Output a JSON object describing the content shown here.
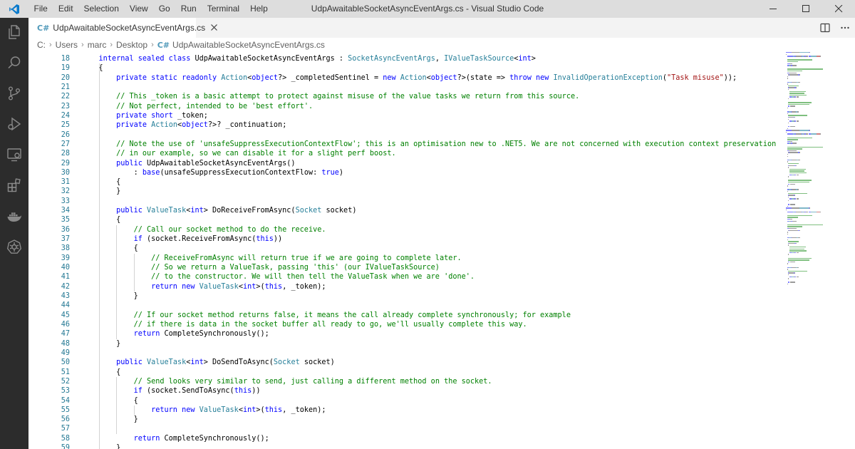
{
  "window": {
    "title": "UdpAwaitableSocketAsyncEventArgs.cs - Visual Studio Code",
    "menu": [
      "File",
      "Edit",
      "Selection",
      "View",
      "Go",
      "Run",
      "Terminal",
      "Help"
    ]
  },
  "activity_bar": {
    "icons": [
      "explorer-icon",
      "search-icon",
      "source-control-icon",
      "run-debug-icon",
      "remote-explorer-icon",
      "extensions-icon",
      "docker-icon",
      "kubernetes-icon"
    ]
  },
  "tabs": [
    {
      "label": "UdpAwaitableSocketAsyncEventArgs.cs",
      "icon": "csharp-file-icon",
      "active": true
    }
  ],
  "breadcrumb": [
    "C:",
    "Users",
    "marc",
    "Desktop",
    "UdpAwaitableSocketAsyncEventArgs.cs"
  ],
  "colors": {
    "keyword": "#0000ff",
    "type": "#267f99",
    "comment": "#008000",
    "string": "#a31515",
    "line_number": "#237893",
    "activity_bar": "#2c2c2c",
    "title_bar": "#dddddd"
  },
  "code": [
    {
      "n": "18",
      "indent": 4,
      "tokens": [
        [
          "k",
          "internal sealed class "
        ],
        [
          "p",
          "UdpAwaitableSocketAsyncEventArgs : "
        ],
        [
          "t",
          "SocketAsyncEventArgs"
        ],
        [
          "p",
          ", "
        ],
        [
          "t",
          "IValueTaskSource"
        ],
        [
          "p",
          "<"
        ],
        [
          "k",
          "int"
        ],
        [
          "p",
          ">"
        ]
      ]
    },
    {
      "n": "19",
      "indent": 4,
      "tokens": [
        [
          "p",
          "{"
        ]
      ]
    },
    {
      "n": "20",
      "indent": 8,
      "tokens": [
        [
          "k",
          "private static readonly "
        ],
        [
          "t",
          "Action"
        ],
        [
          "p",
          "<"
        ],
        [
          "k",
          "object"
        ],
        [
          "p",
          "?> _completedSentinel = "
        ],
        [
          "k",
          "new "
        ],
        [
          "t",
          "Action"
        ],
        [
          "p",
          "<"
        ],
        [
          "k",
          "object"
        ],
        [
          "p",
          "?>(state => "
        ],
        [
          "k",
          "throw new "
        ],
        [
          "t",
          "InvalidOperationException"
        ],
        [
          "p",
          "("
        ],
        [
          "s",
          "\"Task misuse\""
        ],
        [
          "p",
          "));"
        ]
      ]
    },
    {
      "n": "21",
      "indent": 0,
      "tokens": []
    },
    {
      "n": "22",
      "indent": 8,
      "tokens": [
        [
          "c",
          "// This _token is a basic attempt to protect against misuse of the value tasks we return from this source."
        ]
      ]
    },
    {
      "n": "23",
      "indent": 8,
      "tokens": [
        [
          "c",
          "// Not perfect, intended to be 'best effort'."
        ]
      ]
    },
    {
      "n": "24",
      "indent": 8,
      "tokens": [
        [
          "k",
          "private short "
        ],
        [
          "p",
          "_token;"
        ]
      ]
    },
    {
      "n": "25",
      "indent": 8,
      "tokens": [
        [
          "k",
          "private "
        ],
        [
          "t",
          "Action"
        ],
        [
          "p",
          "<"
        ],
        [
          "k",
          "object"
        ],
        [
          "p",
          "?>? _continuation;"
        ]
      ]
    },
    {
      "n": "26",
      "indent": 0,
      "tokens": []
    },
    {
      "n": "27",
      "indent": 8,
      "tokens": [
        [
          "c",
          "// Note the use of 'unsafeSuppressExecutionContextFlow'; this is an optimisation new to .NET5. We are not concerned with execution context preservation"
        ]
      ]
    },
    {
      "n": "28",
      "indent": 8,
      "tokens": [
        [
          "c",
          "// in our example, so we can disable it for a slight perf boost."
        ]
      ]
    },
    {
      "n": "29",
      "indent": 8,
      "tokens": [
        [
          "k",
          "public "
        ],
        [
          "p",
          "UdpAwaitableSocketAsyncEventArgs()"
        ]
      ]
    },
    {
      "n": "30",
      "indent": 12,
      "tokens": [
        [
          "p",
          ": "
        ],
        [
          "k",
          "base"
        ],
        [
          "p",
          "(unsafeSuppressExecutionContextFlow: "
        ],
        [
          "k",
          "true"
        ],
        [
          "p",
          ")"
        ]
      ]
    },
    {
      "n": "31",
      "indent": 8,
      "tokens": [
        [
          "p",
          "{"
        ]
      ]
    },
    {
      "n": "32",
      "indent": 8,
      "tokens": [
        [
          "p",
          "}"
        ]
      ]
    },
    {
      "n": "33",
      "indent": 0,
      "tokens": []
    },
    {
      "n": "34",
      "indent": 8,
      "tokens": [
        [
          "k",
          "public "
        ],
        [
          "t",
          "ValueTask"
        ],
        [
          "p",
          "<"
        ],
        [
          "k",
          "int"
        ],
        [
          "p",
          "> DoReceiveFromAsync("
        ],
        [
          "t",
          "Socket"
        ],
        [
          "p",
          " socket)"
        ]
      ]
    },
    {
      "n": "35",
      "indent": 8,
      "tokens": [
        [
          "p",
          "{"
        ]
      ]
    },
    {
      "n": "36",
      "indent": 12,
      "tokens": [
        [
          "c",
          "// Call our socket method to do the receive."
        ]
      ]
    },
    {
      "n": "37",
      "indent": 12,
      "tokens": [
        [
          "k",
          "if "
        ],
        [
          "p",
          "(socket.ReceiveFromAsync("
        ],
        [
          "k",
          "this"
        ],
        [
          "p",
          "))"
        ]
      ]
    },
    {
      "n": "38",
      "indent": 12,
      "tokens": [
        [
          "p",
          "{"
        ]
      ]
    },
    {
      "n": "39",
      "indent": 16,
      "tokens": [
        [
          "c",
          "// ReceiveFromAsync will return true if we are going to complete later."
        ]
      ]
    },
    {
      "n": "40",
      "indent": 16,
      "tokens": [
        [
          "c",
          "// So we return a ValueTask, passing 'this' (our IValueTaskSource)"
        ]
      ]
    },
    {
      "n": "41",
      "indent": 16,
      "tokens": [
        [
          "c",
          "// to the constructor. We will then tell the ValueTask when we are 'done'."
        ]
      ]
    },
    {
      "n": "42",
      "indent": 16,
      "tokens": [
        [
          "k",
          "return new "
        ],
        [
          "t",
          "ValueTask"
        ],
        [
          "p",
          "<"
        ],
        [
          "k",
          "int"
        ],
        [
          "p",
          ">("
        ],
        [
          "k",
          "this"
        ],
        [
          "p",
          ", _token);"
        ]
      ]
    },
    {
      "n": "43",
      "indent": 12,
      "tokens": [
        [
          "p",
          "}"
        ]
      ]
    },
    {
      "n": "44",
      "indent": 0,
      "tokens": []
    },
    {
      "n": "45",
      "indent": 12,
      "tokens": [
        [
          "c",
          "// If our socket method returns false, it means the call already complete synchronously; for example"
        ]
      ]
    },
    {
      "n": "46",
      "indent": 12,
      "tokens": [
        [
          "c",
          "// if there is data in the socket buffer all ready to go, we'll usually complete this way."
        ]
      ]
    },
    {
      "n": "47",
      "indent": 12,
      "tokens": [
        [
          "k",
          "return "
        ],
        [
          "p",
          "CompleteSynchronously();"
        ]
      ]
    },
    {
      "n": "48",
      "indent": 8,
      "tokens": [
        [
          "p",
          "}"
        ]
      ]
    },
    {
      "n": "49",
      "indent": 0,
      "tokens": []
    },
    {
      "n": "50",
      "indent": 8,
      "tokens": [
        [
          "k",
          "public "
        ],
        [
          "t",
          "ValueTask"
        ],
        [
          "p",
          "<"
        ],
        [
          "k",
          "int"
        ],
        [
          "p",
          "> DoSendToAsync("
        ],
        [
          "t",
          "Socket"
        ],
        [
          "p",
          " socket)"
        ]
      ]
    },
    {
      "n": "51",
      "indent": 8,
      "tokens": [
        [
          "p",
          "{"
        ]
      ]
    },
    {
      "n": "52",
      "indent": 12,
      "tokens": [
        [
          "c",
          "// Send looks very similar to send, just calling a different method on the socket."
        ]
      ]
    },
    {
      "n": "53",
      "indent": 12,
      "tokens": [
        [
          "k",
          "if "
        ],
        [
          "p",
          "(socket.SendToAsync("
        ],
        [
          "k",
          "this"
        ],
        [
          "p",
          "))"
        ]
      ]
    },
    {
      "n": "54",
      "indent": 12,
      "tokens": [
        [
          "p",
          "{"
        ]
      ]
    },
    {
      "n": "55",
      "indent": 16,
      "tokens": [
        [
          "k",
          "return new "
        ],
        [
          "t",
          "ValueTask"
        ],
        [
          "p",
          "<"
        ],
        [
          "k",
          "int"
        ],
        [
          "p",
          ">("
        ],
        [
          "k",
          "this"
        ],
        [
          "p",
          ", _token);"
        ]
      ]
    },
    {
      "n": "56",
      "indent": 12,
      "tokens": [
        [
          "p",
          "}"
        ]
      ]
    },
    {
      "n": "57",
      "indent": 0,
      "tokens": []
    },
    {
      "n": "58",
      "indent": 12,
      "tokens": [
        [
          "k",
          "return "
        ],
        [
          "p",
          "CompleteSynchronously();"
        ]
      ]
    },
    {
      "n": "59",
      "indent": 8,
      "tokens": [
        [
          "p",
          "}"
        ]
      ]
    }
  ]
}
